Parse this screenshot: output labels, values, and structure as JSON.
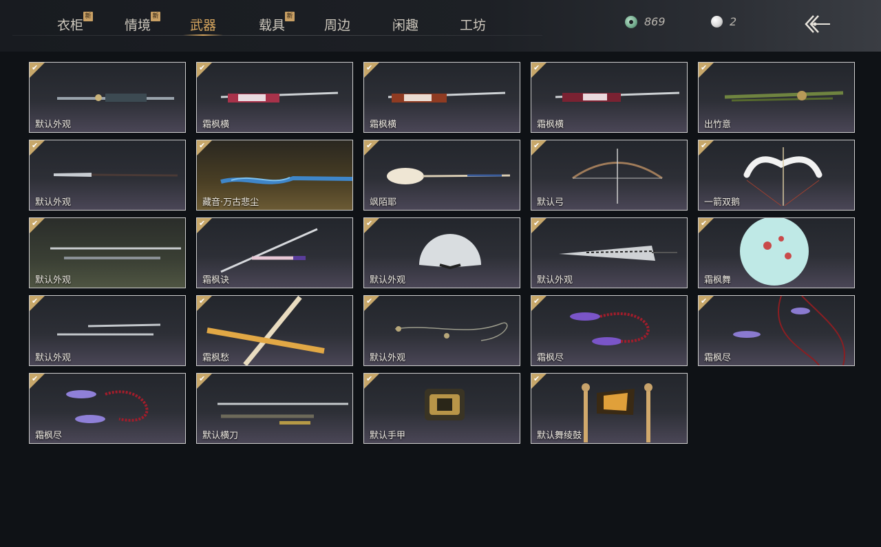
{
  "tabs": [
    {
      "label": "衣柜",
      "new": "新"
    },
    {
      "label": "情境",
      "new": "新"
    },
    {
      "label": "武器",
      "new": ""
    },
    {
      "label": "载具",
      "new": "新"
    },
    {
      "label": "周边",
      "new": ""
    },
    {
      "label": "闲趣",
      "new": ""
    },
    {
      "label": "工坊",
      "new": ""
    }
  ],
  "active_tab": "武器",
  "currency": {
    "jade": {
      "amount": "869",
      "icon": "jade-coin-icon"
    },
    "pearl": {
      "amount": "2",
      "icon": "pearl-icon"
    }
  },
  "back_icon": "back-arrow-icon",
  "cards": [
    {
      "label": "默认外观",
      "icon": "sword-icon"
    },
    {
      "label": "霜枫横",
      "icon": "sword-icon"
    },
    {
      "label": "霜枫横",
      "icon": "sword-icon"
    },
    {
      "label": "霜枫横",
      "icon": "sword-icon"
    },
    {
      "label": "出竹意",
      "icon": "bamboo-icon"
    },
    {
      "label": "默认外观",
      "icon": "spear-icon"
    },
    {
      "label": "藏音·万古悲尘",
      "icon": "spear-icon"
    },
    {
      "label": "飒陌耶",
      "icon": "staff-icon"
    },
    {
      "label": "默认弓",
      "icon": "bow-icon"
    },
    {
      "label": "一箭双鹅",
      "icon": "bow-icon"
    },
    {
      "label": "默认外观",
      "icon": "twin-blade-icon"
    },
    {
      "label": "霜枫诀",
      "icon": "sword-icon"
    },
    {
      "label": "默认外观",
      "icon": "fan-icon"
    },
    {
      "label": "默认外观",
      "icon": "fan-icon"
    },
    {
      "label": "霜枫舞",
      "icon": "umbrella-icon"
    },
    {
      "label": "默认外观",
      "icon": "twin-blade-icon"
    },
    {
      "label": "霜枫愁",
      "icon": "crossed-sword-icon"
    },
    {
      "label": "默认外观",
      "icon": "rope-dart-icon"
    },
    {
      "label": "霜枫尽",
      "icon": "rope-dart-icon"
    },
    {
      "label": "霜枫尽",
      "icon": "rope-dart-icon"
    },
    {
      "label": "霜枫尽",
      "icon": "rope-dart-icon"
    },
    {
      "label": "默认横刀",
      "icon": "sword-icon"
    },
    {
      "label": "默认手甲",
      "icon": "gauntlet-icon"
    },
    {
      "label": "默认舞绫鼓",
      "icon": "drum-icon"
    }
  ]
}
